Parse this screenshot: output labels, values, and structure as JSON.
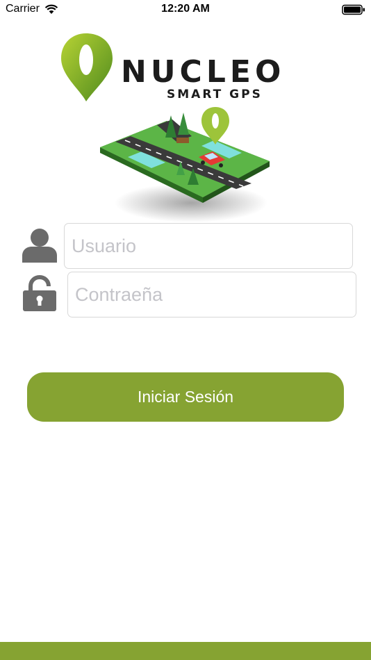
{
  "status_bar": {
    "carrier": "Carrier",
    "time": "12:20 AM",
    "wifi_icon": "wifi-icon",
    "battery_icon": "battery-icon"
  },
  "brand": {
    "name": "NUCLEO",
    "tagline": "SMART GPS",
    "logo_icon": "location-pin-icon",
    "accent_color": "#86a332"
  },
  "form": {
    "username_placeholder": "Usuario",
    "password_placeholder": "Contraeña",
    "username_icon": "user-icon",
    "password_icon": "unlock-icon"
  },
  "login_button": {
    "label": "Iniciar Sesión",
    "color": "#86a332"
  }
}
